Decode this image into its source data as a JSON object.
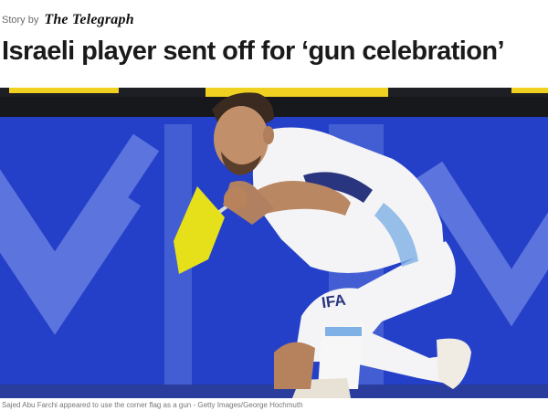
{
  "byline": {
    "prefix": "Story by",
    "publisher": "The Telegraph"
  },
  "article": {
    "headline": "Israeli player sent off for ‘gun celebration’"
  },
  "photo": {
    "shirt_text": "IFA",
    "caption": "Sajed Abu Farchi appeared to use the corner flag as a gun - Getty Images/George Hochmuth"
  },
  "colors": {
    "billboard_blue": "#2540c8",
    "banner_yellow": "#f0d020",
    "flag_yellow": "#e6e01a",
    "kit_white": "#f4f4f6",
    "kit_lightblue": "#7fb0e6"
  }
}
